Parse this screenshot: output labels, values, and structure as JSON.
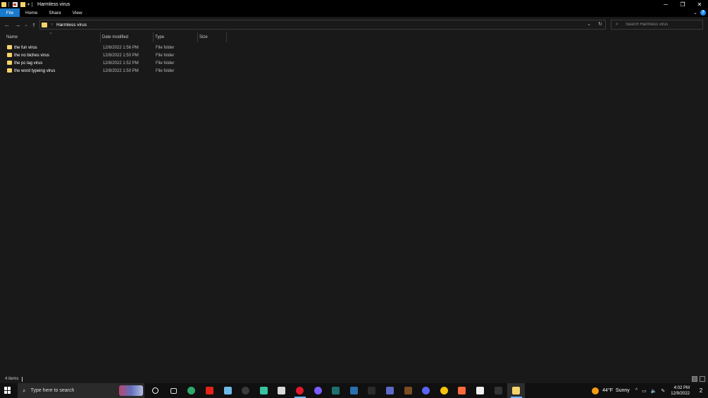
{
  "window": {
    "title": "Harmless virus",
    "controls": {
      "minimize": "─",
      "restore": "❐",
      "close": "✕"
    }
  },
  "ribbon": {
    "tabs": [
      "File",
      "Home",
      "Share",
      "View"
    ],
    "help": "?",
    "expand": "⌄"
  },
  "nav": {
    "back": "←",
    "forward": "→",
    "recent": "⌄",
    "up": "↑",
    "path_sep": "›",
    "path": "Harmless virus",
    "dropdown": "⌄",
    "refresh": "↻"
  },
  "search": {
    "icon": "⌕",
    "placeholder": "Search Harmless virus"
  },
  "columns": {
    "name": "Name",
    "date": "Date modified",
    "type": "Type",
    "size": "Size",
    "sort_caret": "^"
  },
  "files": [
    {
      "name": "the fun virus",
      "date": "12/8/2022 1:56 PM",
      "type": "File folder"
    },
    {
      "name": "the no biches virus",
      "date": "12/8/2022 1:50 PM",
      "type": "File folder"
    },
    {
      "name": "the pc lag virus",
      "date": "12/8/2022 1:52 PM",
      "type": "File folder"
    },
    {
      "name": "the word typeing virus",
      "date": "12/8/2022 1:50 PM",
      "type": "File folder"
    }
  ],
  "status": {
    "items": "4 items"
  },
  "taskbar": {
    "search_icon": "⌕",
    "search_text": "Type here to search",
    "apps": [
      {
        "name": "cortana-icon",
        "color": "#101010"
      },
      {
        "name": "task-view-icon",
        "color": "#101010"
      },
      {
        "name": "edge-icon",
        "color": "#2ea86b"
      },
      {
        "name": "youtube-icon",
        "color": "#e62117"
      },
      {
        "name": "app-icon",
        "color": "#6fb9e8"
      },
      {
        "name": "obs-icon",
        "color": "#3a3a3a"
      },
      {
        "name": "app-green-icon",
        "color": "#39c2a1"
      },
      {
        "name": "notepad-icon",
        "color": "#d9d9d9"
      },
      {
        "name": "opera-icon",
        "color": "#e3192d"
      },
      {
        "name": "messenger-icon",
        "color": "#7b5cff"
      },
      {
        "name": "app-teal-icon",
        "color": "#1f6f6f"
      },
      {
        "name": "steam-icon",
        "color": "#2a6fae"
      },
      {
        "name": "epic-games-icon",
        "color": "#2b2b2b"
      },
      {
        "name": "davinci-icon",
        "color": "#5b6ac7"
      },
      {
        "name": "minecraft-icon",
        "color": "#7a4d22"
      },
      {
        "name": "discord-icon",
        "color": "#5865f2"
      },
      {
        "name": "chrome-icon",
        "color": "#f4c20d"
      },
      {
        "name": "app-drop-icon",
        "color": "#ff6a3d"
      },
      {
        "name": "file-icon",
        "color": "#f0f0f0"
      },
      {
        "name": "app-dark-icon",
        "color": "#333333"
      },
      {
        "name": "file-explorer-icon",
        "color": "#f6d36b"
      }
    ],
    "weather": {
      "temp": "44°F",
      "condition": "Sunny"
    },
    "tray": {
      "chevron": "^",
      "icon1": "▭",
      "volume": "🔈",
      "pen": "✎"
    },
    "clock": {
      "time": "4:02 PM",
      "date": "12/9/2022"
    },
    "notifications": "2"
  }
}
